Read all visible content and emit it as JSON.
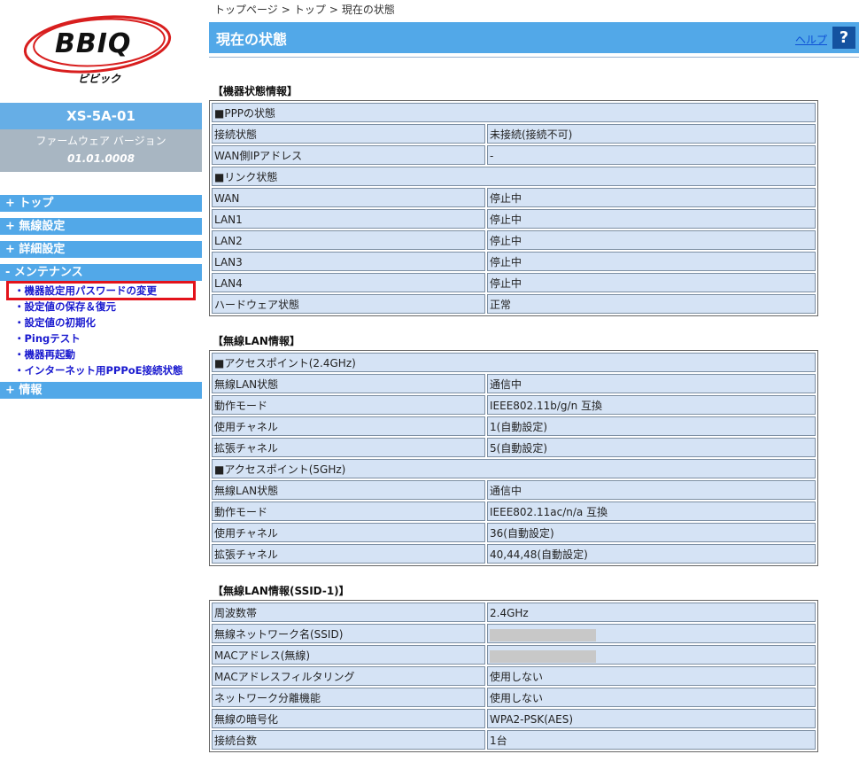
{
  "logo": {
    "text": "BBIQ",
    "sub": "ビビック"
  },
  "device": {
    "model": "XS-5A-01",
    "firmware_label": "ファームウェア バージョン",
    "firmware_version": "01.01.0008"
  },
  "nav": {
    "top": "+ トップ",
    "wireless": "+ 無線設定",
    "detail": "+ 詳細設定",
    "maintenance": "- メンテナンス",
    "info": "+ 情報",
    "maintenance_items": [
      "・機器設定用パスワードの変更",
      "・設定値の保存＆復元",
      "・設定値の初期化",
      "・Pingテスト",
      "・機器再起動",
      "・インターネット用PPPoE接続状態"
    ]
  },
  "breadcrumb": {
    "item1": "トップページ",
    "item2": "トップ",
    "item3": "現在の状態",
    "sep": ">"
  },
  "page": {
    "title": "現在の状態",
    "help_label": "ヘルプ",
    "help_icon": "?"
  },
  "device_status": {
    "title": "【機器状態情報】",
    "ppp_header": "■PPPの状態",
    "connection_label": "接続状態",
    "connection_value": "未接続(接続不可)",
    "wan_ip_label": "WAN側IPアドレス",
    "wan_ip_value": "-",
    "link_header": "■リンク状態",
    "wan_label": "WAN",
    "wan_value": "停止中",
    "lan1_label": "LAN1",
    "lan1_value": "停止中",
    "lan2_label": "LAN2",
    "lan2_value": "停止中",
    "lan3_label": "LAN3",
    "lan3_value": "停止中",
    "lan4_label": "LAN4",
    "lan4_value": "停止中",
    "hw_label": "ハードウェア状態",
    "hw_value": "正常"
  },
  "wlan": {
    "title": "【無線LAN情報】",
    "ap24_header": "■アクセスポイント(2.4GHz)",
    "ap24_status_label": "無線LAN状態",
    "ap24_status_value": "通信中",
    "ap24_mode_label": "動作モード",
    "ap24_mode_value": "IEEE802.11b/g/n 互換",
    "ap24_channel_label": "使用チャネル",
    "ap24_channel_value": "1(自動設定)",
    "ap24_ext_label": "拡張チャネル",
    "ap24_ext_value": "5(自動設定)",
    "ap5_header": "■アクセスポイント(5GHz)",
    "ap5_status_label": "無線LAN状態",
    "ap5_status_value": "通信中",
    "ap5_mode_label": "動作モード",
    "ap5_mode_value": "IEEE802.11ac/n/a 互換",
    "ap5_channel_label": "使用チャネル",
    "ap5_channel_value": "36(自動設定)",
    "ap5_ext_label": "拡張チャネル",
    "ap5_ext_value": "40,44,48(自動設定)"
  },
  "ssid": {
    "title": "【無線LAN情報(SSID-1)】",
    "band_label": "周波数帯",
    "band_value": "2.4GHz",
    "ssid_label": "無線ネットワーク名(SSID)",
    "mac_label": "MACアドレス(無線)",
    "macfilter_label": "MACアドレスフィルタリング",
    "macfilter_value": "使用しない",
    "isolation_label": "ネットワーク分離機能",
    "isolation_value": "使用しない",
    "encryption_label": "無線の暗号化",
    "encryption_value": "WPA2-PSK(AES)",
    "clients_label": "接続台数",
    "clients_value": "1台"
  },
  "colors": {
    "accent": "#52a8e8",
    "cell_bg": "#d5e3f5",
    "highlight": "#e3131b",
    "nav_link": "#1a1acf"
  }
}
